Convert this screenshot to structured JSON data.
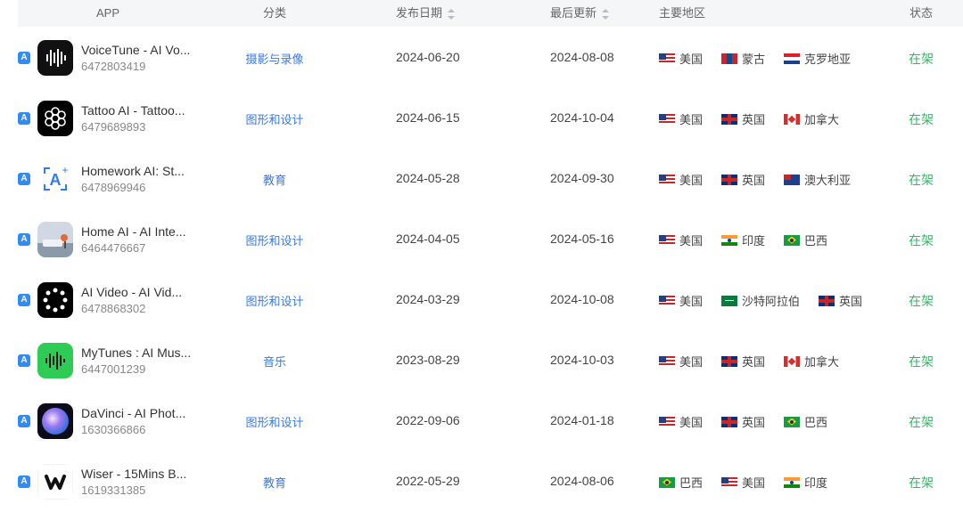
{
  "header": {
    "app": "APP",
    "category": "分类",
    "release_date": "发布日期",
    "last_update": "最后更新",
    "regions": "主要地区",
    "status": "状态"
  },
  "colors": {
    "category_link": "#3a7ae0",
    "status_green": "#35b563",
    "store_badge": "#2f8cf3"
  },
  "rows": [
    {
      "name": "VoiceTune - AI Vo...",
      "id": "6472803419",
      "icon": "waveform-icon",
      "category": "摄影与录像",
      "release_date": "2024-06-20",
      "last_update": "2024-08-08",
      "regions": [
        {
          "flag": "us-flag-icon",
          "name": "美国"
        },
        {
          "flag": "mn-flag-icon",
          "name": "蒙古"
        },
        {
          "flag": "hr-flag-icon",
          "name": "克罗地亚"
        }
      ],
      "status": "在架"
    },
    {
      "name": "Tattoo AI - Tattoo...",
      "id": "6479689893",
      "icon": "flower-circles-icon",
      "category": "图形和设计",
      "release_date": "2024-06-15",
      "last_update": "2024-10-04",
      "regions": [
        {
          "flag": "us-flag-icon",
          "name": "美国"
        },
        {
          "flag": "gb-flag-icon",
          "name": "英国"
        },
        {
          "flag": "ca-flag-icon",
          "name": "加拿大"
        }
      ],
      "status": "在架"
    },
    {
      "name": "Homework AI: St...",
      "id": "6478969946",
      "icon": "letter-a-scan-icon",
      "category": "教育",
      "release_date": "2024-05-28",
      "last_update": "2024-09-30",
      "regions": [
        {
          "flag": "us-flag-icon",
          "name": "美国"
        },
        {
          "flag": "gb-flag-icon",
          "name": "英国"
        },
        {
          "flag": "au-flag-icon",
          "name": "澳大利亚"
        }
      ],
      "status": "在架"
    },
    {
      "name": "Home AI - AI Inte...",
      "id": "6464476667",
      "icon": "room-interior-icon",
      "category": "图形和设计",
      "release_date": "2024-04-05",
      "last_update": "2024-05-16",
      "regions": [
        {
          "flag": "us-flag-icon",
          "name": "美国"
        },
        {
          "flag": "in-flag-icon",
          "name": "印度"
        },
        {
          "flag": "br-flag-icon",
          "name": "巴西"
        }
      ],
      "status": "在架"
    },
    {
      "name": "AI Video - AI Vid...",
      "id": "6478868302",
      "icon": "dots-ring-icon",
      "category": "图形和设计",
      "release_date": "2024-03-29",
      "last_update": "2024-10-08",
      "regions": [
        {
          "flag": "us-flag-icon",
          "name": "美国"
        },
        {
          "flag": "sa-flag-icon",
          "name": "沙特阿拉伯"
        },
        {
          "flag": "gb-flag-icon",
          "name": "英国"
        }
      ],
      "status": "在架"
    },
    {
      "name": "MyTunes : AI Mus...",
      "id": "6447001239",
      "icon": "music-wave-icon",
      "category": "音乐",
      "release_date": "2023-08-29",
      "last_update": "2024-10-03",
      "regions": [
        {
          "flag": "us-flag-icon",
          "name": "美国"
        },
        {
          "flag": "gb-flag-icon",
          "name": "英国"
        },
        {
          "flag": "ca-flag-icon",
          "name": "加拿大"
        }
      ],
      "status": "在架"
    },
    {
      "name": "DaVinci - AI Phot...",
      "id": "1630366866",
      "icon": "gradient-orb-icon",
      "category": "图形和设计",
      "release_date": "2022-09-06",
      "last_update": "2024-01-18",
      "regions": [
        {
          "flag": "us-flag-icon",
          "name": "美国"
        },
        {
          "flag": "gb-flag-icon",
          "name": "英国"
        },
        {
          "flag": "br-flag-icon",
          "name": "巴西"
        }
      ],
      "status": "在架"
    },
    {
      "name": "Wiser - 15Mins B...",
      "id": "1619331385",
      "icon": "letter-w-icon",
      "category": "教育",
      "release_date": "2022-05-29",
      "last_update": "2024-08-06",
      "regions": [
        {
          "flag": "br-flag-icon",
          "name": "巴西"
        },
        {
          "flag": "us-flag-icon",
          "name": "美国"
        },
        {
          "flag": "in-flag-icon",
          "name": "印度"
        }
      ],
      "status": "在架"
    }
  ]
}
